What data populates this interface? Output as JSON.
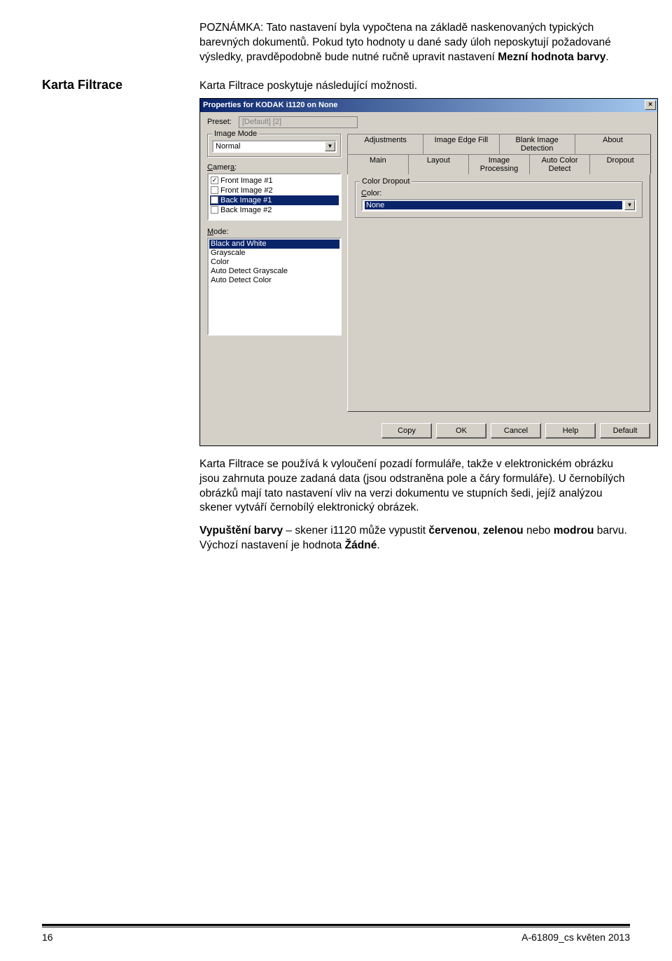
{
  "note": {
    "label": "POZNÁMKA:",
    "text": "Tato nastavení byla vypočtena na základě naskenovaných typických barevných dokumentů. Pokud tyto hodnoty u dané sady úloh neposkytují požadované výsledky, pravděpodobně bude nutné ručně upravit nastavení",
    "bold_tail": "Mezní hodnota barvy",
    "tail_period": "."
  },
  "section": {
    "heading": "Karta Filtrace",
    "intro": "Karta Filtrace poskytuje následující možnosti."
  },
  "dialog": {
    "title": "Properties for KODAK i1120 on None",
    "close": "×",
    "preset_label": "Preset:",
    "preset_value": "[Default] [2]",
    "image_mode_label": "Image Mode",
    "image_mode_value": "Normal",
    "camera_label": "Camera:",
    "camera_items": [
      {
        "label": "Front Image #1",
        "checked": true,
        "selected": false
      },
      {
        "label": "Front Image #2",
        "checked": false,
        "selected": false
      },
      {
        "label": "Back Image #1",
        "checked": false,
        "selected": true
      },
      {
        "label": "Back Image #2",
        "checked": false,
        "selected": false
      }
    ],
    "mode_label": "Mode:",
    "mode_items": [
      {
        "label": "Black and White",
        "selected": true
      },
      {
        "label": "Grayscale",
        "selected": false
      },
      {
        "label": "Color",
        "selected": false
      },
      {
        "label": "Auto Detect Grayscale",
        "selected": false
      },
      {
        "label": "Auto Detect Color",
        "selected": false
      }
    ],
    "tabs_back": [
      "Adjustments",
      "Image Edge Fill",
      "Blank Image Detection",
      "About"
    ],
    "tabs_front": [
      "Main",
      "Layout",
      "Image Processing",
      "Auto Color Detect",
      "Dropout"
    ],
    "active_tab": "Dropout",
    "dropout_group_label": "Color Dropout",
    "dropout_color_label": "Color:",
    "dropout_color_value": "None",
    "buttons": [
      "Copy",
      "OK",
      "Cancel",
      "Help",
      "Default"
    ]
  },
  "para1": "Karta Filtrace se používá k vyloučení pozadí formuláře, takže v elektronickém obrázku jsou zahrnuta pouze zadaná data (jsou odstraněna pole a čáry formuláře). U černobílých obrázků mají tato nastavení vliv na verzi dokumentu ve stupních šedi, jejíž analýzou skener vytváří černobílý elektronický obrázek.",
  "para2": {
    "lead_bold": "Vypuštění barvy",
    "mid": " – skener i1120 může vypustit ",
    "b1": "červenou",
    "c": ", ",
    "b2": "zelenou",
    "mid2": " nebo ",
    "b3": "modrou",
    "mid3": " barvu. Výchozí nastavení je hodnota ",
    "b4": "Žádné",
    "end": "."
  },
  "footer": {
    "page": "16",
    "docid": "A-61809_cs  květen 2013"
  }
}
